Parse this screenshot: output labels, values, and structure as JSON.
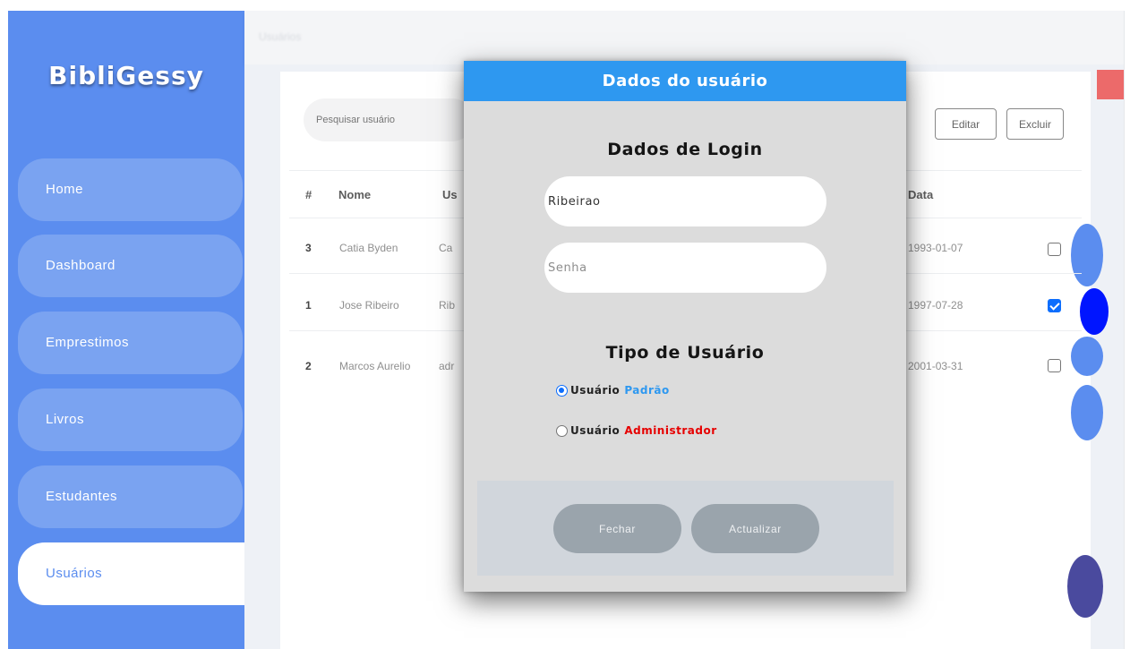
{
  "sidebar": {
    "brand": "BibliGessy",
    "items": [
      {
        "label": "Home"
      },
      {
        "label": "Dashboard"
      },
      {
        "label": "Emprestimos"
      },
      {
        "label": "Livros"
      },
      {
        "label": "Estudantes"
      },
      {
        "label": "Usuários",
        "active": true
      }
    ]
  },
  "topbar": {
    "label": "Usuários"
  },
  "toolbar": {
    "search_placeholder": "Pesquisar usuário",
    "edit_label": "Editar",
    "delete_label": "Excluir"
  },
  "table": {
    "headers": {
      "index": "#",
      "name": "Nome",
      "user": "Us",
      "date": "Data"
    },
    "rows": [
      {
        "index": "3",
        "name": "Catia Byden",
        "user": "Ca",
        "date": "1993-01-07",
        "checked": false
      },
      {
        "index": "1",
        "name": "Jose Ribeiro",
        "user": "Rib",
        "date": "1997-07-28",
        "checked": true
      },
      {
        "index": "2",
        "name": "Marcos Aurelio",
        "user": "adr",
        "date": "2001-03-31",
        "checked": false
      }
    ]
  },
  "modal": {
    "title": "Dados do usuário",
    "login_title": "Dados de Login",
    "username_value": "Ribeirao",
    "password_placeholder": "Senha",
    "type_title": "Tipo de Usuário",
    "options": [
      {
        "prefix": "Usuário",
        "word": "Padrão",
        "selected": true
      },
      {
        "prefix": "Usuário",
        "word": "Administrador",
        "selected": false
      }
    ],
    "close_label": "Fechar",
    "update_label": "Actualizar"
  },
  "colors": {
    "sidebar": "#5b8def",
    "modal_header": "#2e98f0",
    "danger": "#e60000",
    "accent_tab": "#ec6a6a"
  }
}
